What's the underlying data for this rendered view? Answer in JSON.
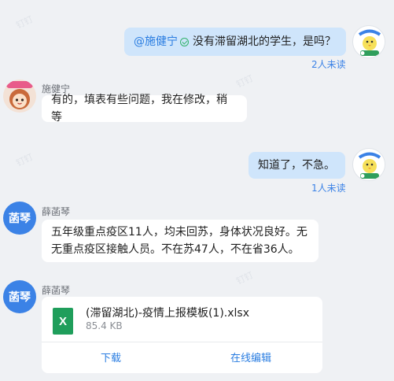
{
  "messages": {
    "m1": {
      "mention": "@施健宁",
      "text": "没有滞留湖北的学生，是吗？",
      "read_status": "2人未读"
    },
    "m2": {
      "sender": "施健宁",
      "text": "有的，填表有些问题，我在修改，稍等"
    },
    "m3": {
      "text": "知道了，不急。",
      "read_status": "1人未读"
    },
    "m4": {
      "sender": "薛菡琴",
      "avatar_text": "菡琴",
      "line1": "五年级重点疫区11人，均未回苏，身体状况良好。无",
      "line2": "无重点疫区接触人员。不在苏47人，不在省36人。"
    },
    "m5": {
      "sender": "薛菡琴",
      "avatar_text": "菡琴",
      "file_icon": "X",
      "file_name": "(滞留湖北)-疫情上报模板(1).xlsx",
      "file_size": "85.4 KB",
      "download_label": "下载",
      "edit_label": "在线编辑"
    }
  },
  "colors": {
    "background": "#eff1f4",
    "outgoing_bubble": "#cfe5fb",
    "incoming_bubble": "#ffffff",
    "accent": "#2a7de1",
    "avatar_blue": "#3b82e6",
    "excel_green": "#1f9e5b"
  }
}
